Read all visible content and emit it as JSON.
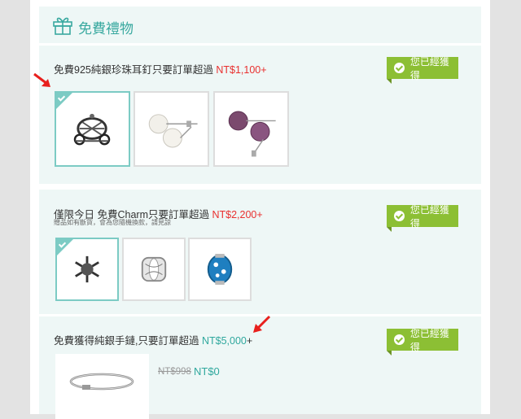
{
  "header": {
    "title": "免費禮物",
    "icon": "gift-icon"
  },
  "offers": [
    {
      "title": "免費925純銀珍珠耳釘只要訂單超過 ",
      "price": "NT$1,100",
      "plus": "+",
      "badge": "您已經獲得",
      "items": [
        "carriage-charm",
        "white-pearl-earrings",
        "purple-pearl-earrings"
      ]
    },
    {
      "title": "僅限今日 免費Charm只要訂單超過 ",
      "price": "NT$2,200",
      "plus": "+",
      "note": "贈品如有斷貨，會為您隨機換款，請見諒",
      "badge": "您已經獲得",
      "items": [
        "snowflake-charm",
        "silver-bead-charm",
        "blue-glass-charm"
      ]
    },
    {
      "title": "免費獲得純銀手鏈,只要訂單超過 ",
      "price": "NT$5,000",
      "plus": "+",
      "badge": "您已經獲得",
      "old_price": "NT$998",
      "new_price": "NT$0",
      "items": [
        "silver-bracelet"
      ]
    }
  ],
  "colors": {
    "accent": "#30a89e",
    "badge": "#8cbf34",
    "price_red": "#e9302f",
    "arrow": "#e8201d"
  }
}
